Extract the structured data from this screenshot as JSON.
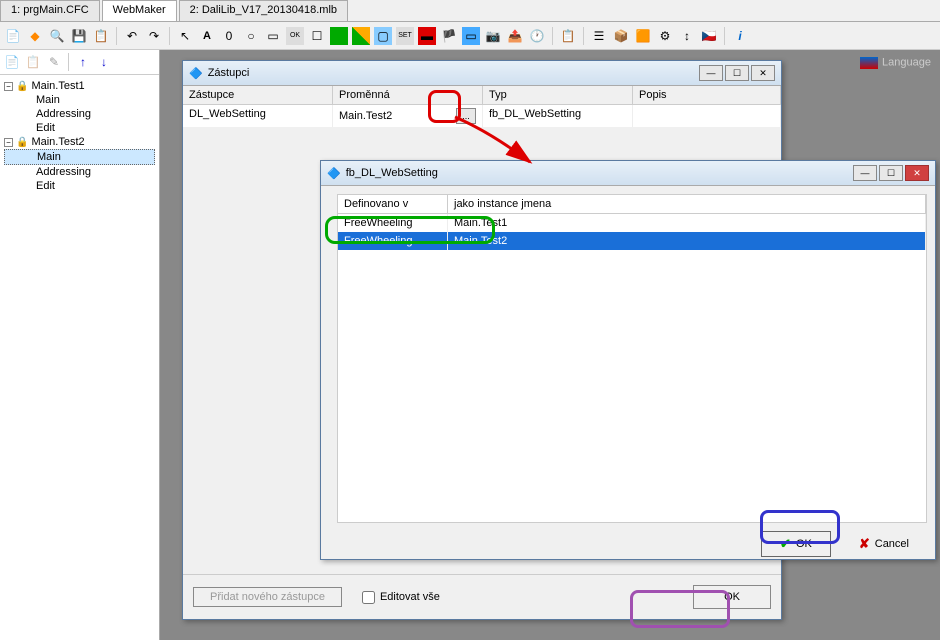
{
  "tabs": {
    "t0": "1: prgMain.CFC",
    "t1": "WebMaker",
    "t2": "2: DaliLib_V17_20130418.mlb"
  },
  "tree": {
    "root1": "Main.Test1",
    "root2": "Main.Test2",
    "child_main": "Main",
    "child_addressing": "Addressing",
    "child_edit": "Edit"
  },
  "zastupci_window": {
    "title": "Zástupci",
    "headers": {
      "c0": "Zástupce",
      "c1": "Proměnná",
      "c2": "Typ",
      "c3": "Popis"
    },
    "row": {
      "c0": "DL_WebSetting",
      "c1": "Main.Test2",
      "c2": "fb_DL_WebSetting",
      "c3": ""
    },
    "add_btn": "Přidat nového zástupce",
    "edit_all": "Editovat vše",
    "ok": "OK"
  },
  "fb_window": {
    "title": "fb_DL_WebSetting",
    "headers": {
      "c0": "Definovano v",
      "c1": "jako instance jmena"
    },
    "rows": [
      {
        "c0": "FreeWheeling",
        "c1": "Main.Test1"
      },
      {
        "c0": "FreeWheeling",
        "c1": "Main.Test2"
      }
    ],
    "ok": "OK",
    "cancel": "Cancel"
  },
  "lang_label": "Language"
}
